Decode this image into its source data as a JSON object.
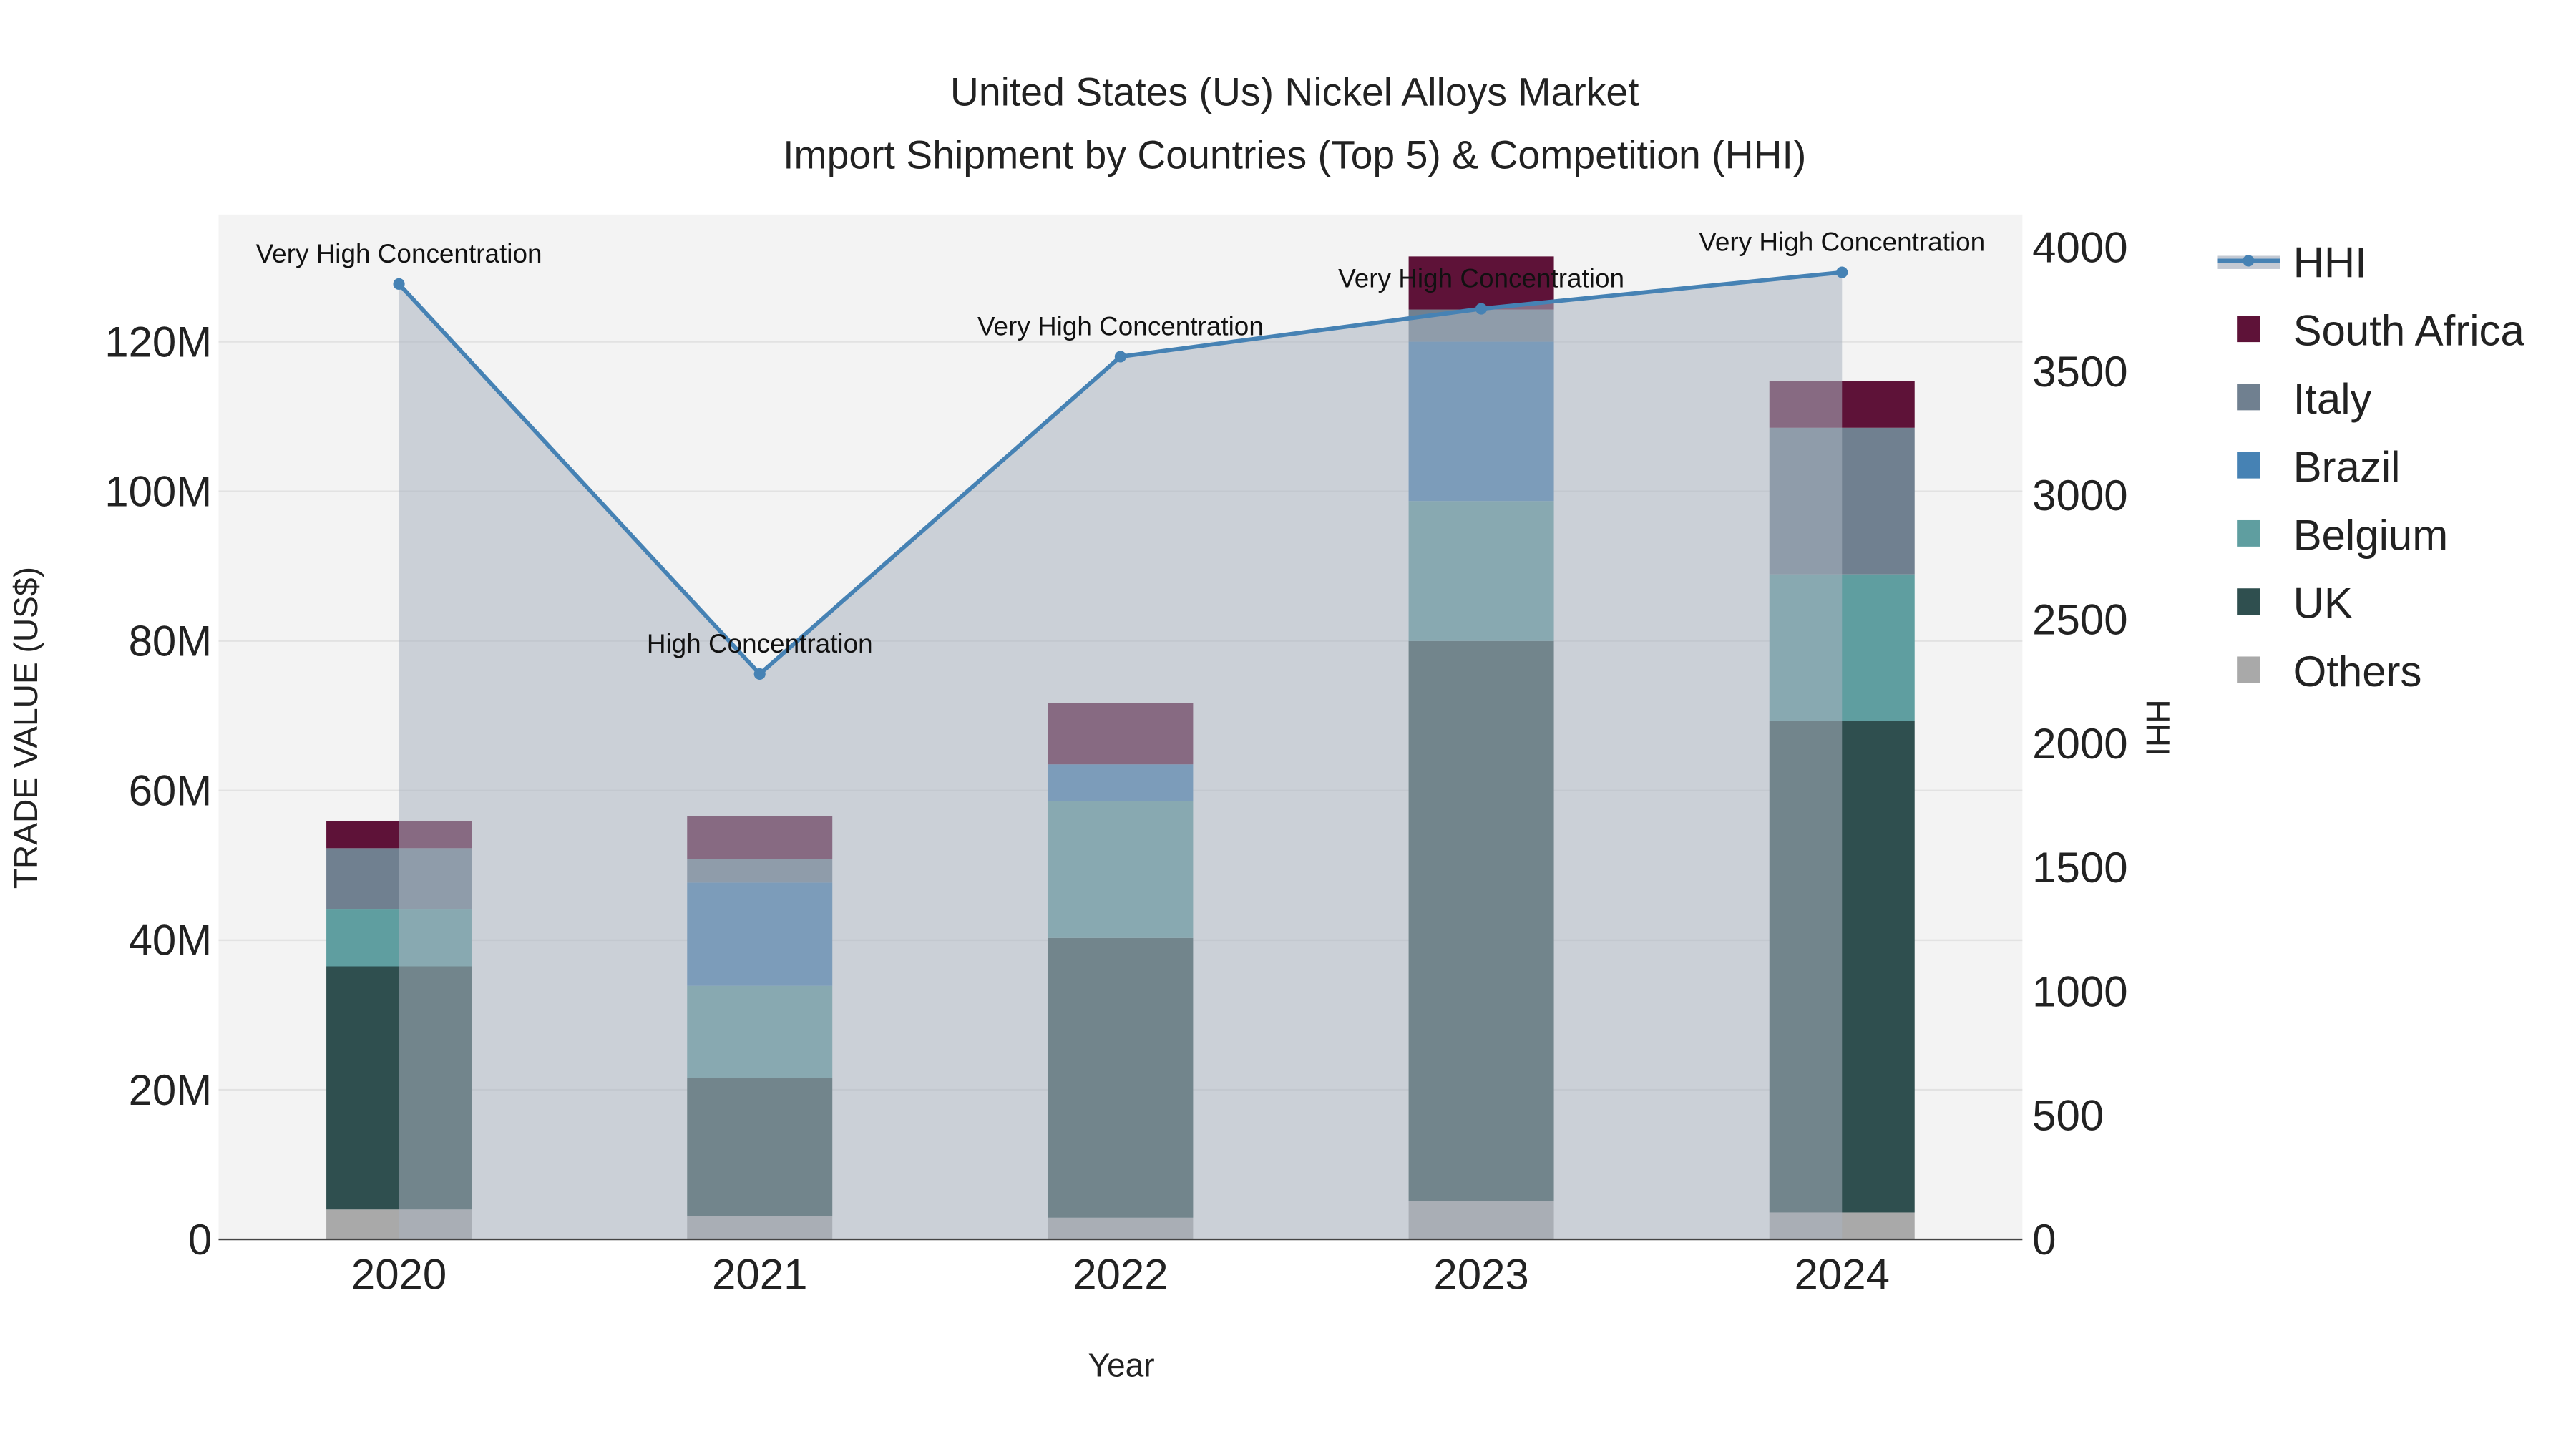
{
  "chart_data": {
    "type": "bar",
    "stacked": true,
    "title": "United States (Us) Nickel Alloys Market",
    "subtitle": "Import Shipment by Countries (Top 5) & Competition (HHI)",
    "xlabel": "Year",
    "ylabel": "TRADE VALUE (US$)",
    "y2label": "HHI",
    "categories": [
      "2020",
      "2021",
      "2022",
      "2023",
      "2024"
    ],
    "ylim": [
      0,
      137
    ],
    "y_unit": "M",
    "yticks": [
      0,
      20,
      40,
      60,
      80,
      100,
      120
    ],
    "ytick_labels": [
      "0",
      "20M",
      "40M",
      "60M",
      "80M",
      "100M",
      "120M"
    ],
    "y2lim": [
      0,
      4133
    ],
    "y2ticks": [
      0,
      500,
      1000,
      1500,
      2000,
      2500,
      3000,
      3500,
      4000
    ],
    "y2tick_labels": [
      "0",
      "500",
      "1000",
      "1500",
      "2000",
      "2500",
      "3000",
      "3500",
      "4000"
    ],
    "series": [
      {
        "name": "Others",
        "color": "#a9a9a9",
        "values": [
          4.0,
          3.1,
          2.9,
          5.1,
          3.6
        ]
      },
      {
        "name": "UK",
        "color": "#2f4f4f",
        "values": [
          32.5,
          18.5,
          37.4,
          74.9,
          65.7
        ]
      },
      {
        "name": "Belgium",
        "color": "#5f9ea0",
        "values": [
          7.6,
          12.3,
          18.3,
          18.7,
          19.6
        ]
      },
      {
        "name": "Brazil",
        "color": "#4682b4",
        "values": [
          0,
          13.8,
          4.9,
          21.3,
          0
        ]
      },
      {
        "name": "Italy",
        "color": "#708090",
        "values": [
          8.2,
          3.1,
          0,
          4.3,
          19.6
        ]
      },
      {
        "name": "South Africa",
        "color": "#5e1238",
        "values": [
          3.6,
          5.8,
          8.2,
          7.1,
          6.2
        ]
      }
    ],
    "hhi": {
      "name": "HHI",
      "color": "#4682b4",
      "values": [
        3853,
        2280,
        3560,
        3753,
        3900
      ],
      "annotations": [
        "Very High Concentration",
        "High Concentration",
        "Very High Concentration",
        "Very High Concentration",
        "Very High Concentration"
      ]
    },
    "legend_order": [
      "HHI",
      "South Africa",
      "Italy",
      "Brazil",
      "Belgium",
      "UK",
      "Others"
    ],
    "legend_position": "right",
    "grid": true
  }
}
